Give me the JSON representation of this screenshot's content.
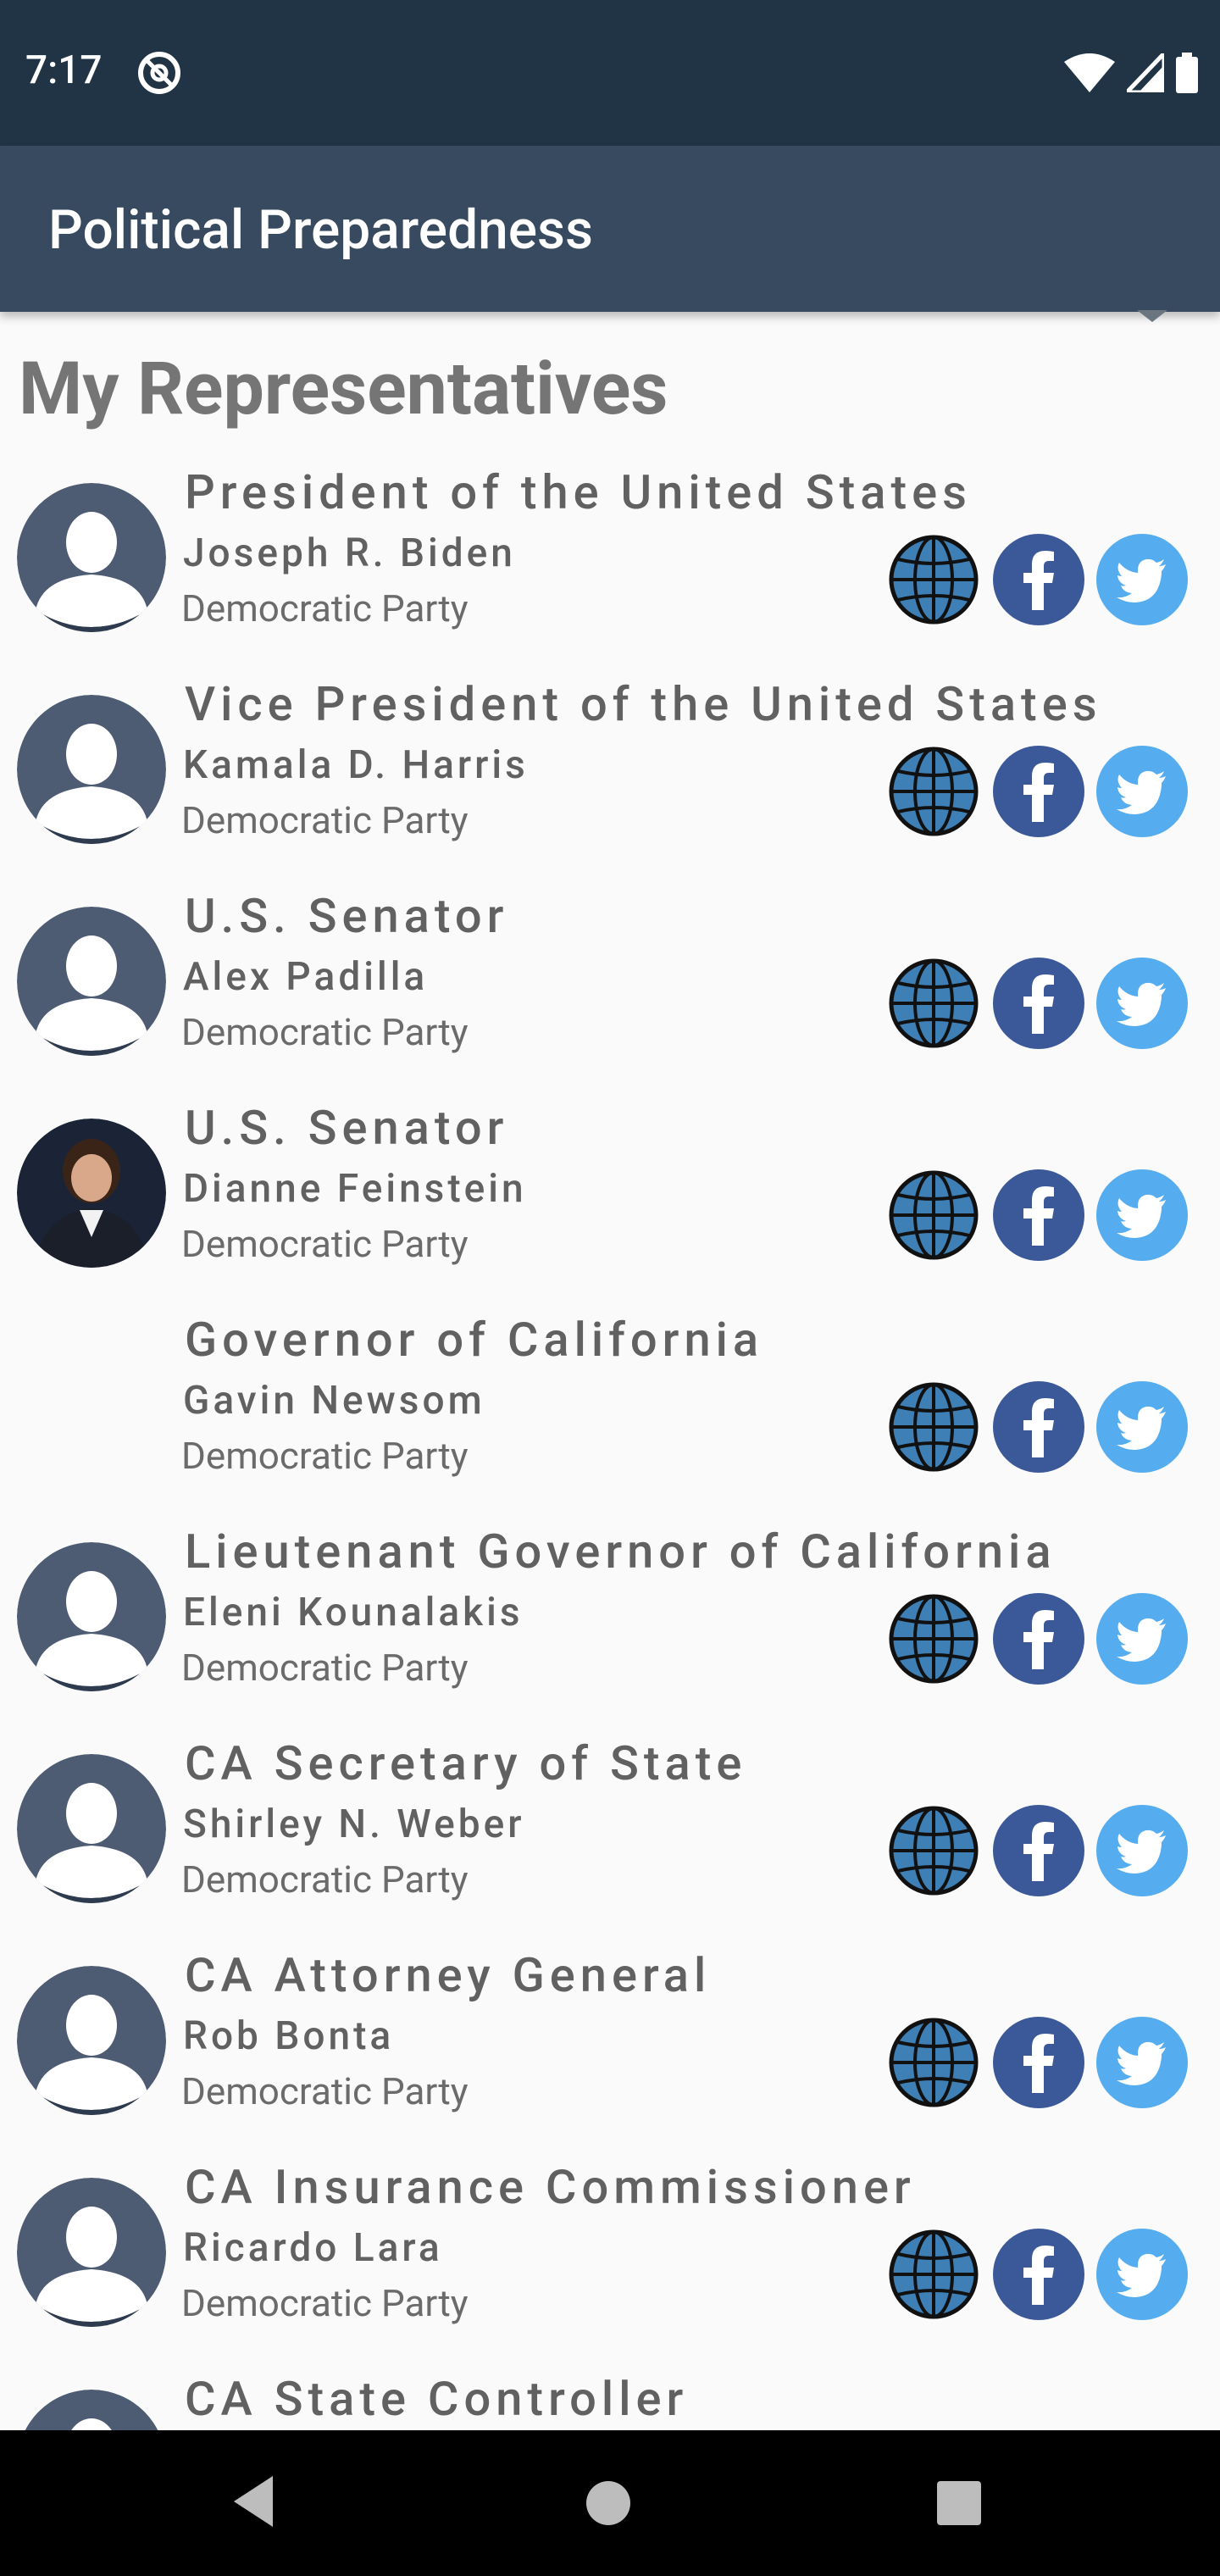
{
  "status_bar": {
    "time": "7:17"
  },
  "app_bar": {
    "title": "Political Preparedness"
  },
  "section": {
    "title": "My Representatives"
  },
  "icons": {
    "website": "globe-icon",
    "facebook": "facebook-icon",
    "twitter": "twitter-icon",
    "web_color": "#3e7fb5",
    "fb_color": "#3b5998",
    "tw_color": "#55acee"
  },
  "representatives": [
    {
      "office": "President of the United States",
      "name": "Joseph R. Biden",
      "party": "Democratic Party",
      "photo": "placeholder"
    },
    {
      "office": "Vice President of the United States",
      "name": "Kamala D. Harris",
      "party": "Democratic Party",
      "photo": "placeholder"
    },
    {
      "office": "U.S. Senator",
      "name": "Alex Padilla",
      "party": "Democratic Party",
      "photo": "placeholder"
    },
    {
      "office": "U.S. Senator",
      "name": "Dianne Feinstein",
      "party": "Democratic Party",
      "photo": "portrait"
    },
    {
      "office": "Governor of California",
      "name": "Gavin Newsom",
      "party": "Democratic Party",
      "photo": "none"
    },
    {
      "office": "Lieutenant Governor of California",
      "name": "Eleni Kounalakis",
      "party": "Democratic Party",
      "photo": "placeholder"
    },
    {
      "office": "CA Secretary of State",
      "name": "Shirley N. Weber",
      "party": "Democratic Party",
      "photo": "placeholder"
    },
    {
      "office": "CA Attorney General",
      "name": "Rob Bonta",
      "party": "Democratic Party",
      "photo": "placeholder"
    },
    {
      "office": "CA Insurance Commissioner",
      "name": "Ricardo Lara",
      "party": "Democratic Party",
      "photo": "placeholder"
    },
    {
      "office": "CA State Controller",
      "name": "",
      "party": "",
      "photo": "placeholder"
    }
  ]
}
